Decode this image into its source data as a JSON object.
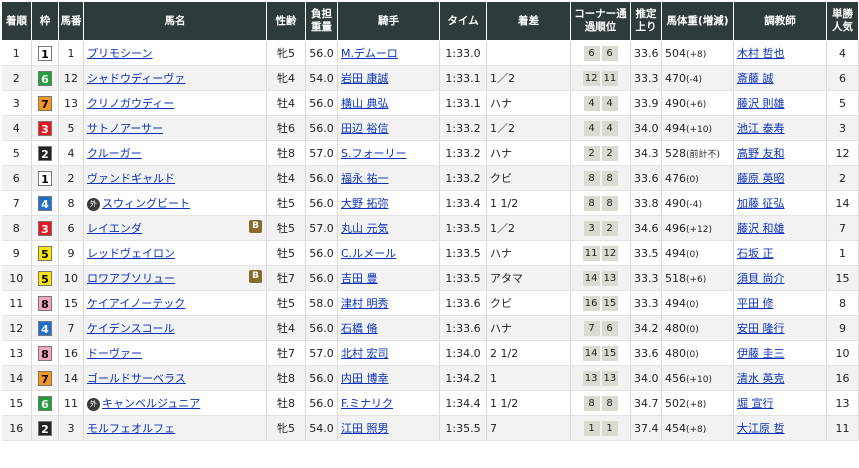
{
  "headers": {
    "rank": "着順",
    "waku": "枠",
    "umaban": "馬番",
    "horse": "馬名",
    "sexage": "性齢",
    "weight": "負担重量",
    "jockey": "騎手",
    "time": "タイム",
    "margin": "着差",
    "corner": "コーナー通過順位",
    "last3f": "推定上り",
    "bodyweight": "馬体重(増減)",
    "trainer": "調教師",
    "popularity": "単勝人気"
  },
  "colors": {
    "header_bg": "#2e3b3b",
    "link": "#0b33b8",
    "waku1": "#ffffff",
    "waku2": "#222222",
    "waku3": "#e8141e",
    "waku4": "#1e6fd0",
    "waku5": "#ffe600",
    "waku6": "#21a03a",
    "waku7": "#f5961e",
    "waku8": "#f7a6c1"
  },
  "rows": [
    {
      "rank": "1",
      "waku": "1",
      "umaban": "1",
      "horse": "プリモシーン",
      "icon": "",
      "blinker": "",
      "sexage": "牝5",
      "weight": "56.0",
      "jockey": "M.デムーロ",
      "time": "1:33.0",
      "margin": "",
      "corner": [
        "6",
        "6"
      ],
      "last3f": "33.6",
      "bw": "504",
      "bwd": "(+8)",
      "trainer": "木村 哲也",
      "pop": "4"
    },
    {
      "rank": "2",
      "waku": "6",
      "umaban": "12",
      "horse": "シャドウディーヴァ",
      "icon": "",
      "blinker": "",
      "sexage": "牝4",
      "weight": "54.0",
      "jockey": "岩田 康誠",
      "time": "1:33.1",
      "margin": "1／2",
      "corner": [
        "12",
        "11"
      ],
      "last3f": "33.3",
      "bw": "470",
      "bwd": "(-4)",
      "trainer": "斎藤 誠",
      "pop": "6"
    },
    {
      "rank": "3",
      "waku": "7",
      "umaban": "13",
      "horse": "クリノガウディー",
      "icon": "",
      "blinker": "",
      "sexage": "牡4",
      "weight": "56.0",
      "jockey": "横山 典弘",
      "time": "1:33.1",
      "margin": "ハナ",
      "corner": [
        "4",
        "4"
      ],
      "last3f": "33.9",
      "bw": "490",
      "bwd": "(+6)",
      "trainer": "藤沢 則雄",
      "pop": "5"
    },
    {
      "rank": "4",
      "waku": "3",
      "umaban": "5",
      "horse": "サトノアーサー",
      "icon": "",
      "blinker": "",
      "sexage": "牡6",
      "weight": "56.0",
      "jockey": "田辺 裕信",
      "time": "1:33.2",
      "margin": "1／2",
      "corner": [
        "4",
        "4"
      ],
      "last3f": "34.0",
      "bw": "494",
      "bwd": "(+10)",
      "trainer": "池江 泰寿",
      "pop": "3"
    },
    {
      "rank": "5",
      "waku": "2",
      "umaban": "4",
      "horse": "クルーガー",
      "icon": "",
      "blinker": "",
      "sexage": "牡8",
      "weight": "57.0",
      "jockey": "S.フォーリー",
      "time": "1:33.2",
      "margin": "ハナ",
      "corner": [
        "2",
        "2"
      ],
      "last3f": "34.3",
      "bw": "528",
      "bwd": "(前計不)",
      "trainer": "高野 友和",
      "pop": "12"
    },
    {
      "rank": "6",
      "waku": "1",
      "umaban": "2",
      "horse": "ヴァンドギャルド",
      "icon": "",
      "blinker": "",
      "sexage": "牡4",
      "weight": "56.0",
      "jockey": "福永 祐一",
      "time": "1:33.2",
      "margin": "クビ",
      "corner": [
        "8",
        "8"
      ],
      "last3f": "33.6",
      "bw": "476",
      "bwd": "(0)",
      "trainer": "藤原 英昭",
      "pop": "2"
    },
    {
      "rank": "7",
      "waku": "4",
      "umaban": "8",
      "horse": "スウィングビート",
      "icon": "外",
      "blinker": "",
      "sexage": "牡5",
      "weight": "56.0",
      "jockey": "大野 拓弥",
      "time": "1:33.4",
      "margin": "1 1/2",
      "corner": [
        "8",
        "8"
      ],
      "last3f": "33.8",
      "bw": "490",
      "bwd": "(-4)",
      "trainer": "加藤 征弘",
      "pop": "14"
    },
    {
      "rank": "8",
      "waku": "3",
      "umaban": "6",
      "horse": "レイエンダ",
      "icon": "",
      "blinker": "B",
      "sexage": "牡5",
      "weight": "57.0",
      "jockey": "丸山 元気",
      "time": "1:33.5",
      "margin": "1／2",
      "corner": [
        "3",
        "2"
      ],
      "last3f": "34.6",
      "bw": "496",
      "bwd": "(+12)",
      "trainer": "藤沢 和雄",
      "pop": "7"
    },
    {
      "rank": "9",
      "waku": "5",
      "umaban": "9",
      "horse": "レッドヴェイロン",
      "icon": "",
      "blinker": "",
      "sexage": "牡5",
      "weight": "56.0",
      "jockey": "C.ルメール",
      "time": "1:33.5",
      "margin": "ハナ",
      "corner": [
        "11",
        "12"
      ],
      "last3f": "33.5",
      "bw": "494",
      "bwd": "(0)",
      "trainer": "石坂 正",
      "pop": "1"
    },
    {
      "rank": "10",
      "waku": "5",
      "umaban": "10",
      "horse": "ロワアブソリュー",
      "icon": "",
      "blinker": "B",
      "sexage": "牡7",
      "weight": "56.0",
      "jockey": "吉田 豊",
      "time": "1:33.5",
      "margin": "アタマ",
      "corner": [
        "14",
        "13"
      ],
      "last3f": "33.3",
      "bw": "518",
      "bwd": "(+6)",
      "trainer": "須貝 尚介",
      "pop": "15"
    },
    {
      "rank": "11",
      "waku": "8",
      "umaban": "15",
      "horse": "ケイアイノーテック",
      "icon": "",
      "blinker": "",
      "sexage": "牡5",
      "weight": "58.0",
      "jockey": "津村 明秀",
      "time": "1:33.6",
      "margin": "クビ",
      "corner": [
        "16",
        "15"
      ],
      "last3f": "33.3",
      "bw": "494",
      "bwd": "(0)",
      "trainer": "平田 修",
      "pop": "8"
    },
    {
      "rank": "12",
      "waku": "4",
      "umaban": "7",
      "horse": "ケイデンスコール",
      "icon": "",
      "blinker": "",
      "sexage": "牡4",
      "weight": "56.0",
      "jockey": "石橋 脩",
      "time": "1:33.6",
      "margin": "ハナ",
      "corner": [
        "7",
        "6"
      ],
      "last3f": "34.2",
      "bw": "480",
      "bwd": "(0)",
      "trainer": "安田 隆行",
      "pop": "9"
    },
    {
      "rank": "13",
      "waku": "8",
      "umaban": "16",
      "horse": "ドーヴァー",
      "icon": "",
      "blinker": "",
      "sexage": "牡7",
      "weight": "57.0",
      "jockey": "北村 宏司",
      "time": "1:34.0",
      "margin": "2 1/2",
      "corner": [
        "14",
        "15"
      ],
      "last3f": "33.6",
      "bw": "480",
      "bwd": "(0)",
      "trainer": "伊藤 圭三",
      "pop": "10"
    },
    {
      "rank": "14",
      "waku": "7",
      "umaban": "14",
      "horse": "ゴールドサーベラス",
      "icon": "",
      "blinker": "",
      "sexage": "牡8",
      "weight": "56.0",
      "jockey": "内田 博幸",
      "time": "1:34.2",
      "margin": "1",
      "corner": [
        "13",
        "13"
      ],
      "last3f": "34.0",
      "bw": "456",
      "bwd": "(+10)",
      "trainer": "清水 英克",
      "pop": "16"
    },
    {
      "rank": "15",
      "waku": "6",
      "umaban": "11",
      "horse": "キャンベルジュニア",
      "icon": "外",
      "blinker": "",
      "sexage": "牡8",
      "weight": "56.0",
      "jockey": "F.ミナリク",
      "time": "1:34.4",
      "margin": "1 1/2",
      "corner": [
        "8",
        "8"
      ],
      "last3f": "34.7",
      "bw": "502",
      "bwd": "(+8)",
      "trainer": "堀 宣行",
      "pop": "13"
    },
    {
      "rank": "16",
      "waku": "2",
      "umaban": "3",
      "horse": "モルフェオルフェ",
      "icon": "",
      "blinker": "",
      "sexage": "牝5",
      "weight": "54.0",
      "jockey": "江田 照男",
      "time": "1:35.5",
      "margin": "7",
      "corner": [
        "1",
        "1"
      ],
      "last3f": "37.4",
      "bw": "454",
      "bwd": "(+8)",
      "trainer": "大江原 哲",
      "pop": "11"
    }
  ]
}
